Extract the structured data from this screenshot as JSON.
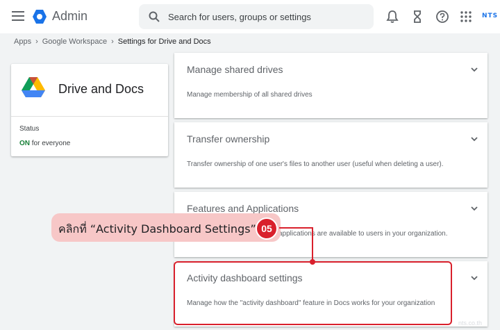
{
  "header": {
    "brand": "Admin",
    "search_placeholder": "Search for users, groups or settings",
    "partner_logo": "NTS"
  },
  "breadcrumb": {
    "items": [
      "Apps",
      "Google Workspace"
    ],
    "current": "Settings for Drive and Docs"
  },
  "app_card": {
    "title": "Drive and Docs",
    "status_label": "Status",
    "status_on": "ON",
    "status_suffix": "for everyone"
  },
  "settings": [
    {
      "title": "Manage shared drives",
      "desc": "Manage membership of all shared drives"
    },
    {
      "title": "Transfer ownership",
      "desc": "Transfer ownership of one user's files to another user (useful when deleting a user)."
    },
    {
      "title": "Features and Applications",
      "desc": "applications are available to users in your organization."
    },
    {
      "title": "Activity dashboard settings",
      "desc": "Manage how the \"activity dashboard\" feature in Docs works for your organization"
    }
  ],
  "callout": {
    "text": "คลิกที่ “Activity Dashboard Settings”",
    "step": "05"
  },
  "watermark": "nts.co.th",
  "colors": {
    "accent": "#d9202c",
    "on": "#188038",
    "brand_blue": "#1a73e8"
  }
}
